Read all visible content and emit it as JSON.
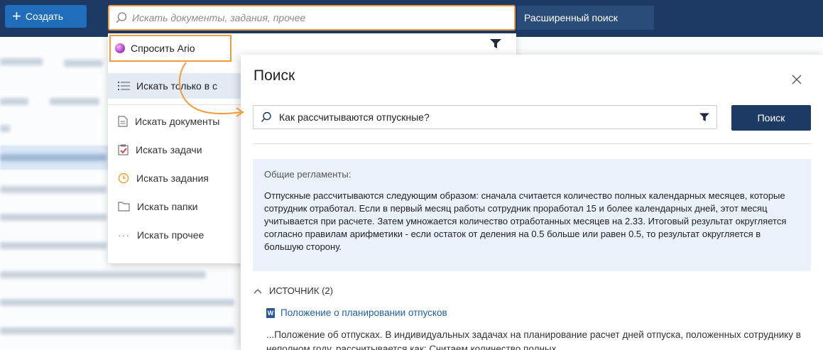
{
  "topbar": {
    "create_label": "Создать",
    "search_placeholder": "Искать документы, задания, прочее",
    "advanced_search_label": "Расширенный поиск"
  },
  "dropdown": {
    "ask_ario_label": "Спросить Ario",
    "items": [
      {
        "label": "Искать только в с",
        "icon": "list-icon"
      },
      {
        "label": "Искать документы",
        "icon": "document-icon"
      },
      {
        "label": "Искать задачи",
        "icon": "task-icon"
      },
      {
        "label": "Искать задания",
        "icon": "clock-icon"
      },
      {
        "label": "Искать папки",
        "icon": "folder-icon"
      },
      {
        "label": "Искать прочее",
        "icon": "ellipsis-icon"
      }
    ]
  },
  "dialog": {
    "title": "Поиск",
    "query": "Как рассчитываются отпускные?",
    "search_button": "Поиск",
    "answer_heading": "Общие регламенты:",
    "answer_text": "Отпускные рассчитываются следующим образом: сначала считается количество полных календарных месяцев, которые сотрудник отработал. Если в первый месяц работы сотрудник проработал 15 и более календарных дней, этот месяц учитывается при расчете. Затем умножается количество отработанных месяцев на 2.33. Итоговый результат округляется согласно правилам арифметики - если остаток от деления на 0.5 больше или равен 0.5, то результат округляется в большую сторону.",
    "sources_label": "ИСТОЧНИК (2)",
    "source_title": "Положение о планировании отпусков",
    "source_snippet": "...Положение об отпусках. В индивидуальных задачах на планирование расчет дней отпуска, положенных сотруднику в неполном году, рассчитывается как: Считаем количество полных"
  },
  "colors": {
    "topbar": "#1c3a63",
    "accent_orange": "#f29a3e",
    "primary_button": "#1f6dbb",
    "answer_bg": "#e9f1fa",
    "link": "#1f5fa8"
  }
}
